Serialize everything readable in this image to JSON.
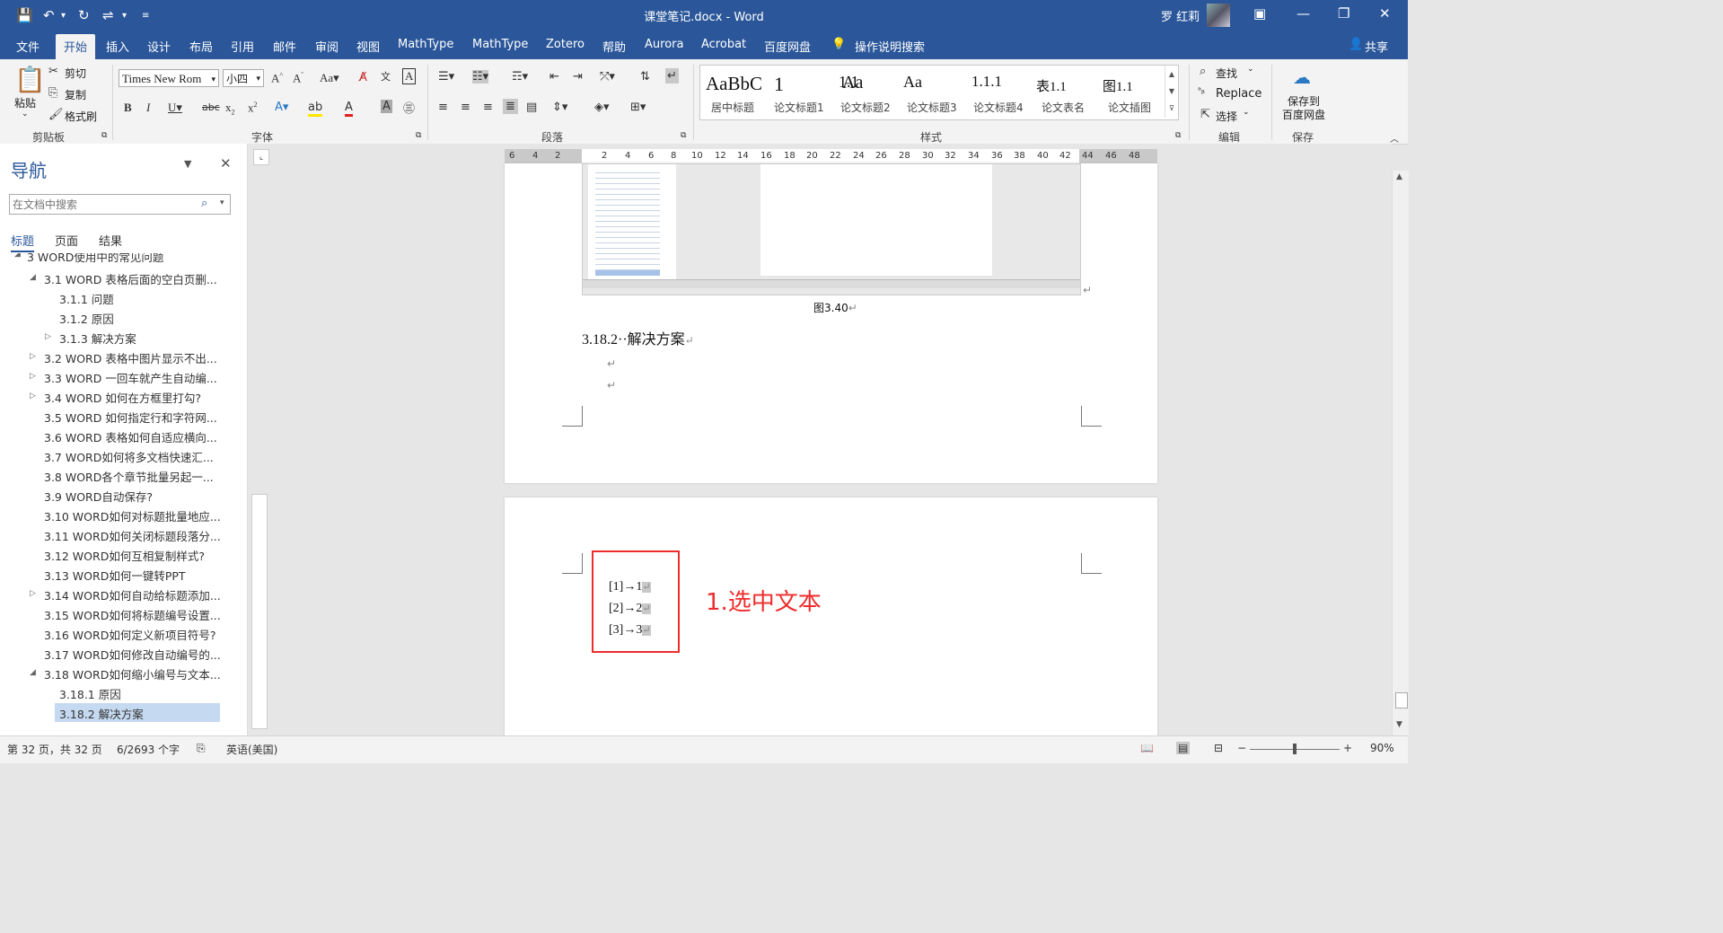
{
  "titlebar": {
    "doc_title": "课堂笔记.docx - Word",
    "user": "罗 红莉",
    "quick_access": [
      "save-icon",
      "undo-icon",
      "redo-icon",
      "touch-mode-icon",
      "customize-icon"
    ]
  },
  "tabs": [
    "文件",
    "开始",
    "插入",
    "设计",
    "布局",
    "引用",
    "邮件",
    "审阅",
    "视图",
    "MathType",
    "MathType",
    "Zotero",
    "帮助",
    "Aurora",
    "Acrobat",
    "百度网盘"
  ],
  "tell_me": "操作说明搜索",
  "share": "共享",
  "clipboard": {
    "paste": "粘贴",
    "cut": "剪切",
    "copy": "复制",
    "format_painter": "格式刷",
    "label": "剪贴板"
  },
  "font": {
    "name": "Times New Rom",
    "size": "小四",
    "label": "字体"
  },
  "paragraph": {
    "label": "段落"
  },
  "styles": {
    "label": "样式",
    "items": [
      {
        "sample": "AaBbC",
        "name": "居中标题"
      },
      {
        "sample": "1",
        "name": "论文标题1"
      },
      {
        "sample": "Aa",
        "name": "论文标题2"
      },
      {
        "sample": "1.1",
        "name": "论文标题3"
      },
      {
        "sample": "1.1.1",
        "name": "论文标题4"
      },
      {
        "sample": "表1.1",
        "name": "论文表名"
      },
      {
        "sample": "图1.1",
        "name": "论文插图"
      }
    ]
  },
  "editing": {
    "find": "查找",
    "replace": "Replace",
    "select": "选择",
    "label": "编辑"
  },
  "save": {
    "button": "保存到\n百度网盘",
    "label": "保存"
  },
  "nav": {
    "title": "导航",
    "search_placeholder": "在文档中搜索",
    "tabs": [
      "标题",
      "页面",
      "结果"
    ],
    "items": [
      {
        "text": "3  WORD使用中的常见问题",
        "level": 1,
        "expanded": true
      },
      {
        "text": "3.1  WORD 表格后面的空白页删...",
        "level": 2,
        "expanded": true
      },
      {
        "text": "3.1.1  问题",
        "level": 3
      },
      {
        "text": "3.1.2  原因",
        "level": 3
      },
      {
        "text": "3.1.3  解决方案",
        "level": 3,
        "collapsed": true
      },
      {
        "text": "3.2  WORD 表格中图片显示不出...",
        "level": 2,
        "collapsed": true
      },
      {
        "text": "3.3  WORD 一回车就产生自动编...",
        "level": 2,
        "collapsed": true
      },
      {
        "text": "3.4  WORD 如何在方框里打勾?",
        "level": 2,
        "collapsed": true
      },
      {
        "text": "3.5  WORD 如何指定行和字符网...",
        "level": 2
      },
      {
        "text": "3.6  WORD 表格如何自适应横向...",
        "level": 2
      },
      {
        "text": "3.7  WORD如何将多文档快速汇...",
        "level": 2
      },
      {
        "text": "3.8  WORD各个章节批量另起一...",
        "level": 2
      },
      {
        "text": "3.9  WORD自动保存?",
        "level": 2
      },
      {
        "text": "3.10  WORD如何对标题批量地应...",
        "level": 2
      },
      {
        "text": "3.11  WORD如何关闭标题段落分...",
        "level": 2
      },
      {
        "text": "3.12  WORD如何互相复制样式?",
        "level": 2
      },
      {
        "text": "3.13  WORD如何一键转PPT",
        "level": 2
      },
      {
        "text": "3.14  WORD如何自动给标题添加...",
        "level": 2,
        "collapsed": true
      },
      {
        "text": "3.15  WORD如何将标题编号设置...",
        "level": 2
      },
      {
        "text": "3.16  WORD如何定义新项目符号?",
        "level": 2
      },
      {
        "text": "3.17  WORD如何修改自动编号的...",
        "level": 2
      },
      {
        "text": "3.18  WORD如何缩小编号与文本...",
        "level": 2,
        "expanded": true
      },
      {
        "text": "3.18.1  原因",
        "level": 3
      },
      {
        "text": "3.18.2  解决方案",
        "level": 3,
        "selected": true
      }
    ]
  },
  "ruler_numbers": [
    "6",
    "4",
    "2",
    "2",
    "4",
    "6",
    "8",
    "10",
    "12",
    "14",
    "16",
    "18",
    "20",
    "22",
    "24",
    "26",
    "28",
    "30",
    "32",
    "34",
    "36",
    "38",
    "40",
    "42",
    "44",
    "46",
    "48"
  ],
  "document": {
    "figure_caption": "图3.40",
    "heading": "3.18.2··解决方案",
    "list_items": [
      "[1]→1",
      "[2]→2",
      "[3]→3"
    ],
    "annotation": "1.选中文本",
    "annotation_color": "#ee2c2c",
    "para_mark": "↵"
  },
  "status": {
    "page": "第 32 页，共 32 页",
    "words": "6/2693 个字",
    "language": "英语(美国)",
    "zoom": "90%"
  },
  "colors": {
    "brand": "#2b579a",
    "selection": "#c5d9f1"
  }
}
